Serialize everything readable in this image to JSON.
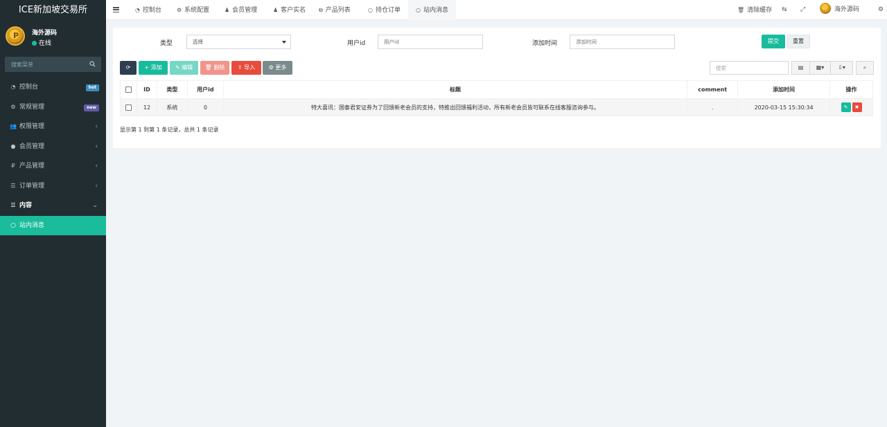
{
  "app": {
    "title": "ICE新加坡交易所"
  },
  "user": {
    "name": "海外源码",
    "status": "在线"
  },
  "sidebar": {
    "search_placeholder": "搜索菜单",
    "items": [
      {
        "label": "控制台",
        "icon": "dashboard-icon",
        "badge": "hot"
      },
      {
        "label": "常规管理",
        "icon": "cogs-icon",
        "badge": "new"
      },
      {
        "label": "权限管理",
        "icon": "group-icon",
        "caret": "‹"
      },
      {
        "label": "会员管理",
        "icon": "user-circle-icon",
        "caret": "‹"
      },
      {
        "label": "产品管理",
        "icon": "ruble-icon",
        "caret": "‹"
      },
      {
        "label": "订单管理",
        "icon": "list-icon",
        "caret": "‹"
      },
      {
        "label": "内容",
        "icon": "list-icon",
        "caret": "⌄"
      },
      {
        "label": "站内消息",
        "icon": "circle-icon"
      }
    ]
  },
  "topnav": {
    "tabs": [
      {
        "label": "控制台",
        "icon": "dashboard-icon"
      },
      {
        "label": "系统配置",
        "icon": "gear-icon"
      },
      {
        "label": "会员管理",
        "icon": "user-icon"
      },
      {
        "label": "客户实名",
        "icon": "user-icon"
      },
      {
        "label": "产品列表",
        "icon": "cubes-icon"
      },
      {
        "label": "持仓订单",
        "icon": "circle-icon"
      },
      {
        "label": "站内消息",
        "icon": "circle-icon"
      }
    ],
    "clear_cache": "清除缓存",
    "user_name": "海外源码"
  },
  "filter": {
    "type_label": "类型",
    "type_value": "选择",
    "user_id_label": "用户id",
    "user_id_placeholder": "用户id",
    "time_label": "添加时间",
    "time_placeholder": "添加时间",
    "submit": "提交",
    "reset": "重置"
  },
  "toolbar": {
    "add": "添加",
    "edit": "编辑",
    "delete": "删除",
    "import": "导入",
    "more": "更多",
    "search_placeholder": "搜索"
  },
  "table": {
    "columns": [
      "ID",
      "类型",
      "用户id",
      "标题",
      "comment",
      "添加时间",
      "操作"
    ],
    "rows": [
      {
        "id": "12",
        "type": "系统",
        "user_id": "0",
        "title": "特大喜讯：国泰君安证券为了回馈新老会员的支持，特推出回馈福利活动，所有新老会员皆可联系在线客服咨询参与。",
        "comment": ".",
        "time": "2020-03-15 15:30:34"
      }
    ]
  },
  "pagination": {
    "info": "显示第 1 到第 1 条记录，总共 1 条记录"
  }
}
